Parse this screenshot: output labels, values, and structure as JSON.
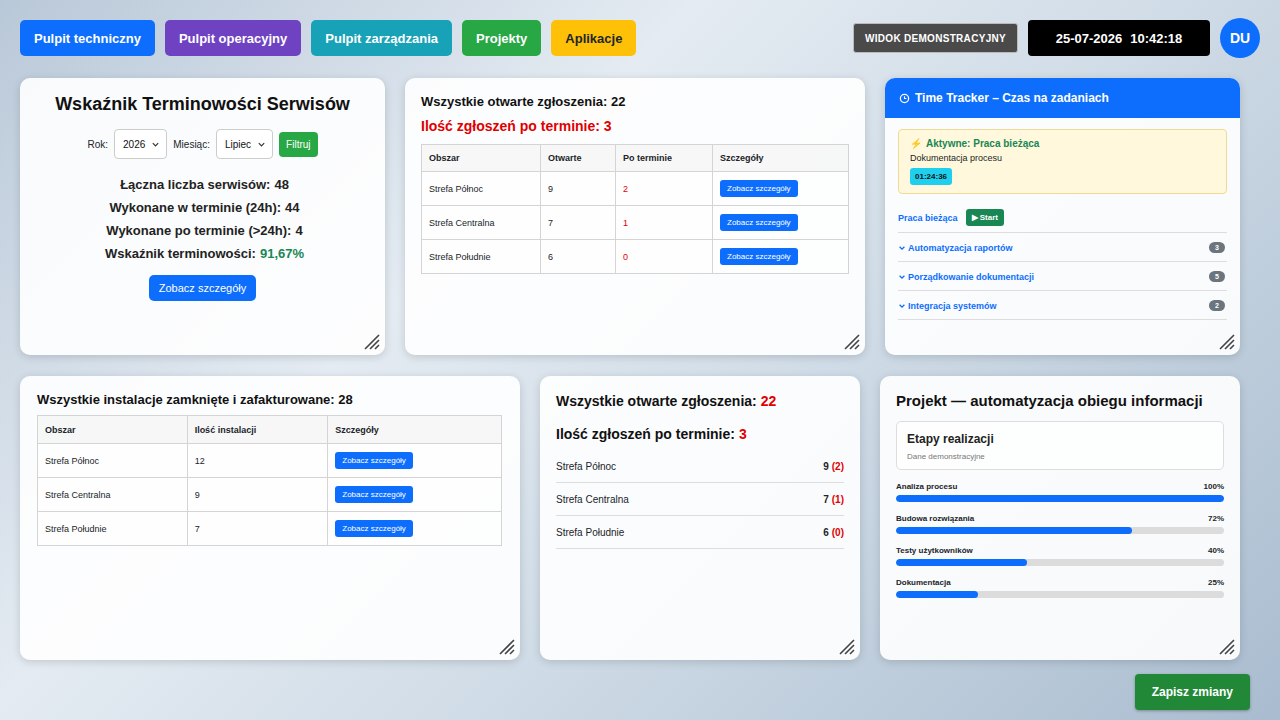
{
  "nav": {
    "buttons": [
      {
        "label": "Pulpit techniczny",
        "color": "#0d6efd",
        "text_color": "#ffffff"
      },
      {
        "label": "Pulpit operacyjny",
        "color": "#6f42c1",
        "text_color": "#ffffff"
      },
      {
        "label": "Pulpit zarządzania",
        "color": "#17a2b8",
        "text_color": "#ffffff"
      },
      {
        "label": "Projekty",
        "color": "#28a745",
        "text_color": "#ffffff"
      },
      {
        "label": "Aplikacje",
        "color": "#ffc107",
        "text_color": "#212529"
      }
    ],
    "demo_view": "WIDOK DEMONSTRACYJNY",
    "clock": {
      "date": "25-07-2026",
      "time": "10:42:18"
    },
    "avatar": "DU"
  },
  "timeliness": {
    "title": "Wskaźnik Terminowości Serwisów",
    "year_label": "Rok:",
    "year": "2026",
    "month_label": "Miesiąc:",
    "month": "Lipiec",
    "filter": "Filtruj",
    "stats": [
      {
        "label": "Łączna liczba serwisów:",
        "value": "48",
        "color": "#222222"
      },
      {
        "label": "Wykonane w terminie (24h):",
        "value": "44",
        "color": "#222222"
      },
      {
        "label": "Wykonane po terminie (>24h):",
        "value": "4",
        "color": "#222222"
      },
      {
        "label": "Wskaźnik terminowości:",
        "value": "91,67%",
        "color": "#198754"
      }
    ],
    "details": "Zobacz szczegóły"
  },
  "open_tickets_table": {
    "title": "Wszystkie otwarte zgłoszenia: 22",
    "overdue": "Ilość zgłoszeń po terminie: 3",
    "columns": [
      "Obszar",
      "Otwarte",
      "Po terminie",
      "Szczegóły"
    ],
    "rows": [
      {
        "area": "Strefa Północ",
        "open": "9",
        "overdue": "2",
        "button": "Zobacz szczegóły"
      },
      {
        "area": "Strefa Centralna",
        "open": "7",
        "overdue": "1",
        "button": "Zobacz szczegóły"
      },
      {
        "area": "Strefa Południe",
        "open": "6",
        "overdue": "0",
        "button": "Zobacz szczegóły"
      }
    ]
  },
  "time_tracker": {
    "title": "Time Tracker – Czas na zadaniach",
    "active": {
      "icon": "⚡",
      "label": "Aktywne: Praca bieżąca",
      "task": "Dokumentacja procesu",
      "timer": "01:24:36"
    },
    "current": {
      "label": "Praca bieżąca",
      "start": "▶ Start"
    },
    "groups": [
      {
        "label": "Automatyzacja raportów",
        "count": "3",
        "expanded": false
      },
      {
        "label": "Porządkowanie dokumentacji",
        "count": "5",
        "expanded": false
      },
      {
        "label": "Integracja systemów",
        "count": "2",
        "expanded": false
      }
    ]
  },
  "installations": {
    "title": "Wszystkie instalacje zamknięte i zafakturowane: 28",
    "columns": [
      "Obszar",
      "Ilość instalacji",
      "Szczegóły"
    ],
    "rows": [
      {
        "area": "Strefa Północ",
        "count": "12",
        "button": "Zobacz szczegóły"
      },
      {
        "area": "Strefa Centralna",
        "count": "9",
        "button": "Zobacz szczegóły"
      },
      {
        "area": "Strefa Południe",
        "count": "7",
        "button": "Zobacz szczegóły"
      }
    ]
  },
  "open_tickets_summary": {
    "title": "Wszystkie otwarte zgłoszenia:",
    "total": "22",
    "overdue_label": "Ilość zgłoszeń po terminie:",
    "overdue": "3",
    "rows": [
      {
        "area": "Strefa Północ",
        "open": "9",
        "overdue": "(2)"
      },
      {
        "area": "Strefa Centralna",
        "open": "7",
        "overdue": "(1)"
      },
      {
        "area": "Strefa Południe",
        "open": "6",
        "overdue": "(0)"
      }
    ]
  },
  "project": {
    "title": "Projekt — automatyzacja obiegu informacji",
    "stages_title": "Etapy realizacji",
    "stages_note": "Dane demonstracyjne",
    "stages": [
      {
        "label": "Analiza procesu",
        "percent": "100%",
        "level": 1
      },
      {
        "label": "Budowa rozwiązania",
        "percent": "72%",
        "level": 0.72
      },
      {
        "label": "Testy użytkowników",
        "percent": "40%",
        "level": 0.4
      },
      {
        "label": "Dokumentacja",
        "percent": "25%",
        "level": 0.25
      }
    ]
  },
  "save_button": "Zapisz zmiany"
}
